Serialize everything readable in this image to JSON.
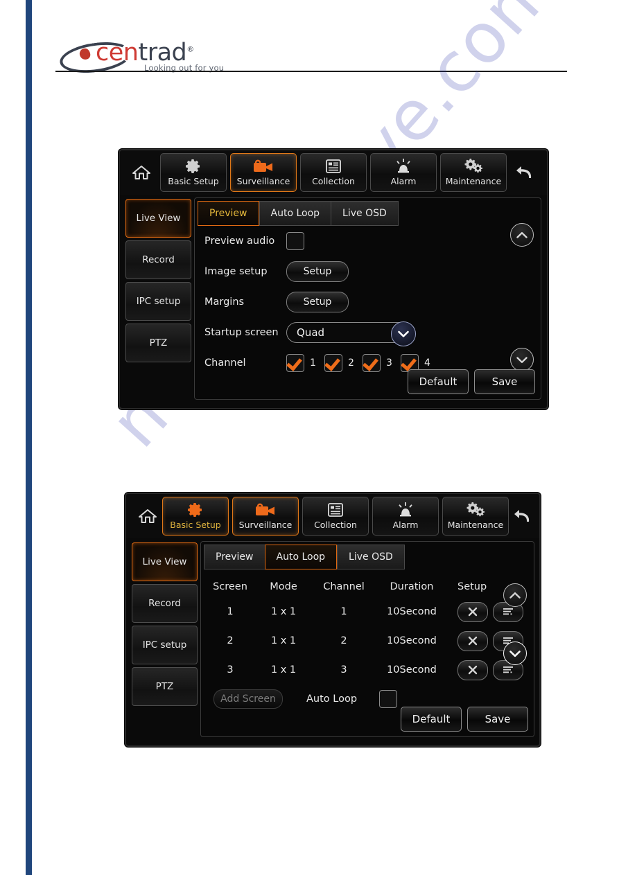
{
  "brand": {
    "name_part1": "cen",
    "name_part2": "trad",
    "registered": "®",
    "tagline": "Looking out for you"
  },
  "watermark": {
    "text": "manualshive.com"
  },
  "nav": {
    "home_icon": "home-icon",
    "back_icon": "back-arrow-icon",
    "items": [
      {
        "label": "Basic Setup",
        "icon": "gear-icon"
      },
      {
        "label": "Surveillance",
        "icon": "video-camera-icon"
      },
      {
        "label": "Collection",
        "icon": "document-list-icon"
      },
      {
        "label": "Alarm",
        "icon": "siren-icon"
      },
      {
        "label": "Maintenance",
        "icon": "gears-icon"
      }
    ]
  },
  "sidebar": {
    "items": [
      {
        "label": "Live View"
      },
      {
        "label": "Record"
      },
      {
        "label": "IPC setup"
      },
      {
        "label": "PTZ"
      }
    ]
  },
  "tabs": [
    {
      "label": "Preview"
    },
    {
      "label": "Auto Loop"
    },
    {
      "label": "Live OSD"
    }
  ],
  "panel_top": {
    "selected_nav": "Surveillance",
    "selected_sidebar": "Live View",
    "selected_tab": "Preview",
    "rows": {
      "preview_audio_label": "Preview audio",
      "preview_audio_checked": false,
      "image_setup_label": "Image setup",
      "image_setup_button": "Setup",
      "margins_label": "Margins",
      "margins_button": "Setup",
      "startup_screen_label": "Startup screen",
      "startup_screen_value": "Quad",
      "channel_label": "Channel",
      "channels": [
        {
          "num": "1",
          "checked": true
        },
        {
          "num": "2",
          "checked": true
        },
        {
          "num": "3",
          "checked": true
        },
        {
          "num": "4",
          "checked": true
        }
      ]
    },
    "footer": {
      "default_label": "Default",
      "save_label": "Save"
    }
  },
  "panel_bottom": {
    "selected_nav": "Basic Setup",
    "selected_sidebar": "Live View",
    "selected_tab": "Auto Loop",
    "table": {
      "headers": [
        "Screen",
        "Mode",
        "Channel",
        "Duration",
        "Setup"
      ],
      "rows": [
        {
          "screen": "1",
          "mode": "1 x 1",
          "channel": "1",
          "duration": "10Second"
        },
        {
          "screen": "2",
          "mode": "1 x 1",
          "channel": "2",
          "duration": "10Second"
        },
        {
          "screen": "3",
          "mode": "1 x 1",
          "channel": "3",
          "duration": "10Second"
        }
      ]
    },
    "add_screen_label": "Add Screen",
    "auto_loop_label": "Auto Loop",
    "auto_loop_checked": false,
    "footer": {
      "default_label": "Default",
      "save_label": "Save"
    }
  },
  "colors": {
    "accent_orange": "#e06a12",
    "amber_text": "#e6b93b",
    "spine_blue": "#20467c",
    "logo_red": "#cf3a33"
  }
}
